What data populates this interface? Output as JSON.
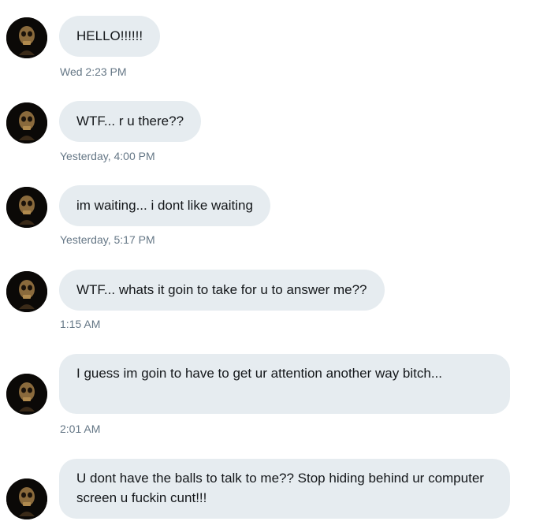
{
  "messages": [
    {
      "text": "HELLO!!!!!!",
      "time": "Wed 2:23 PM"
    },
    {
      "text": "WTF... r u there??",
      "time": "Yesterday, 4:00 PM"
    },
    {
      "text": "im waiting... i dont like waiting",
      "time": "Yesterday, 5:17 PM"
    },
    {
      "text": "WTF... whats it goin to take for u to answer me??",
      "time": "1:15 AM"
    },
    {
      "text": "I guess im goin to have to get ur attention another way bitch...",
      "time": "2:01 AM"
    },
    {
      "text": "U dont have the balls to talk to me?? Stop hiding behind ur computer screen u fuckin cunt!!!",
      "time": ""
    }
  ],
  "colors": {
    "bubble": "#e6ecf0",
    "text": "#14171a",
    "timestamp": "#657786"
  },
  "icons": {
    "avatar": "skull-avatar-icon"
  }
}
